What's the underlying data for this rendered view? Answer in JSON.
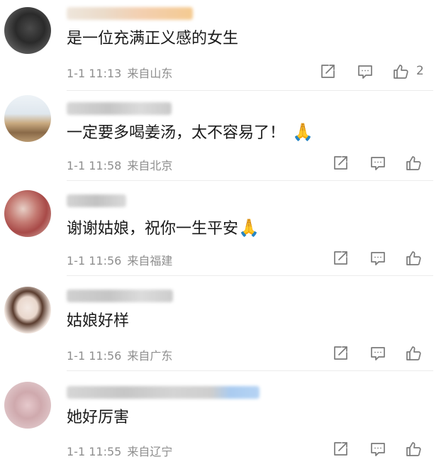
{
  "comments": [
    {
      "text": "是一位充满正义感的女生",
      "date": "1-1 11:13",
      "location": "来自山东",
      "likes": "2",
      "avatar_colors": [
        "#3a3a3a",
        "#5a5a5a",
        "#222222"
      ],
      "name_colors": [
        "#e8d5c0",
        "#f3c9a8",
        "#f2b77a"
      ]
    },
    {
      "text": "一定要多喝姜汤，太不容易了！",
      "emoji": "🙏",
      "date": "1-1 11:58",
      "location": "来自北京",
      "likes": "",
      "avatar_colors": [
        "#dde6ef",
        "#c9b08a",
        "#8a6a48"
      ],
      "name_colors": [
        "#cfcfcf",
        "#bdbdbd",
        "#d8d8d8"
      ]
    },
    {
      "text": "谢谢姑娘，祝你一生平安",
      "emoji": "🙏",
      "date": "1-1 11:56",
      "location": "来自福建",
      "likes": "",
      "avatar_colors": [
        "#d9b8b0",
        "#b55a55",
        "#e6d0c8"
      ],
      "name_colors": [
        "#cccccc",
        "#b8b8b8",
        "#d4d4d4"
      ]
    },
    {
      "text": "姑娘好样",
      "date": "1-1 11:56",
      "location": "来自广东",
      "likes": "",
      "avatar_colors": [
        "#f1e6df",
        "#6b4a3a",
        "#e9d9d0"
      ],
      "name_colors": [
        "#c8c8c8",
        "#bcbcbc",
        "#d6d6d6"
      ]
    },
    {
      "text": "她好厉害",
      "date": "1-1 11:55",
      "location": "来自辽宁",
      "likes": "",
      "avatar_colors": [
        "#e8d0d0",
        "#c9a5a8",
        "#d8bcc0"
      ],
      "name_colors": [
        "#c9c9c9",
        "#bdbdbd",
        "#9cc3ee"
      ]
    }
  ]
}
